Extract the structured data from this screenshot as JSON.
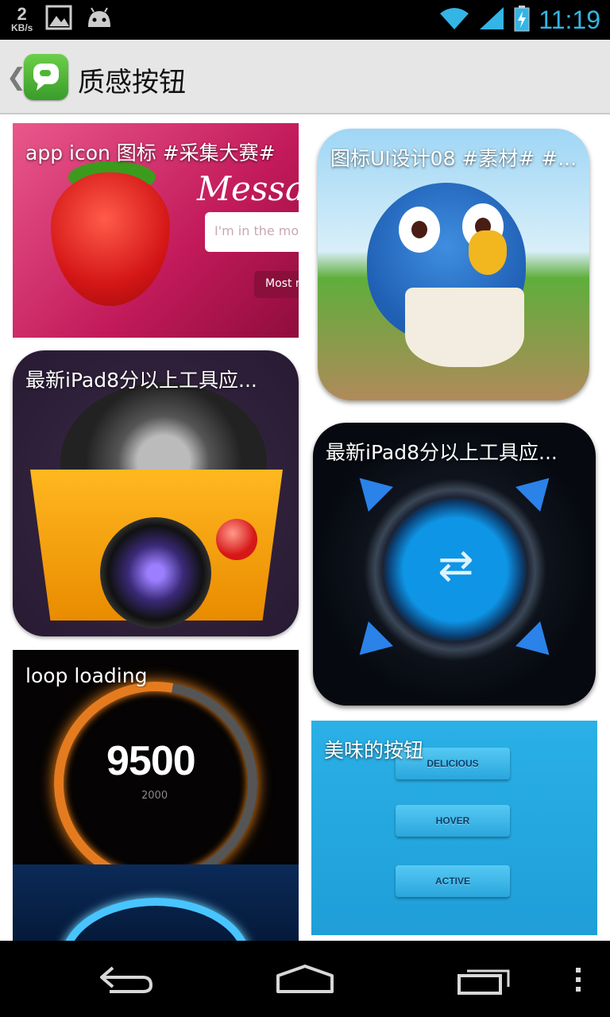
{
  "status_bar": {
    "net_speed_value": "2",
    "net_speed_unit": "KB/s",
    "time": "11:19",
    "left_icons": [
      "image-icon",
      "android-icon"
    ],
    "right_icons": [
      "wifi-icon",
      "signal-icon",
      "battery-charging-icon"
    ]
  },
  "action_bar": {
    "title": "质感按钮",
    "back_glyph": "❮"
  },
  "cards": [
    {
      "caption": "app icon 图标 #采集大赛#",
      "image_text": {
        "title": "Messa",
        "input_placeholder": "I'm in the moo",
        "button": "Most r"
      }
    },
    {
      "caption": "图标UI设计08 #素材# #..."
    },
    {
      "caption": "最新iPad8分以上工具应..."
    },
    {
      "caption": "最新iPad8分以上工具应...",
      "image_text": {
        "arrows": "⇄"
      }
    },
    {
      "caption": "loop loading",
      "image_text": {
        "value": "9500",
        "sub_value": "2000"
      }
    },
    {
      "caption": "美味的按钮",
      "image_text": {
        "buttons": [
          "DELICIOUS",
          "HOVER",
          "ACTIVE"
        ]
      }
    }
  ],
  "nav_bar": {
    "icons": [
      "back-icon",
      "home-icon",
      "recent-apps-icon",
      "overflow-menu-icon"
    ]
  },
  "colors": {
    "accent": "#33b5e5",
    "action_bar_bg": "#e6e6e6",
    "status_bar_bg": "#000000"
  }
}
